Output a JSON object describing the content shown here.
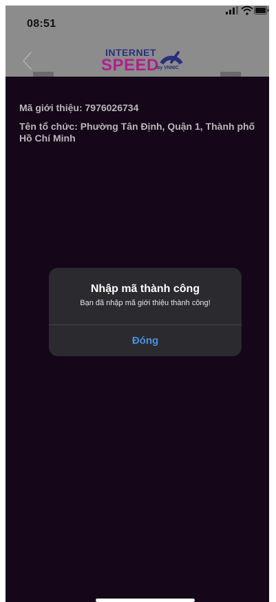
{
  "status_bar": {
    "time": "08:51"
  },
  "header": {
    "logo_line1": "INTERNET",
    "logo_line2": "SPEED",
    "logo_by": "by VNNIC"
  },
  "content": {
    "referral_code": "Mã giới thiệu: 7976026734",
    "organization": "Tên tổ chức: Phường Tân Định, Quận 1, Thành phố Hồ Chí Minh"
  },
  "alert": {
    "title": "Nhập mã thành công",
    "message": "Bạn đã nhập mã giới thiệu thành công!",
    "button_label": "Đóng"
  },
  "colors": {
    "background": "#150619",
    "header_dim": "#8c8c8c",
    "alert_bg": "#2b2a2e",
    "accent_blue": "#4a90e2",
    "brand_magenta": "#b0208c",
    "brand_navy": "#2a2f7a"
  },
  "icons": [
    "back-chevron-icon",
    "signal-icon",
    "wifi-icon",
    "battery-icon",
    "speed-gauge-icon"
  ]
}
